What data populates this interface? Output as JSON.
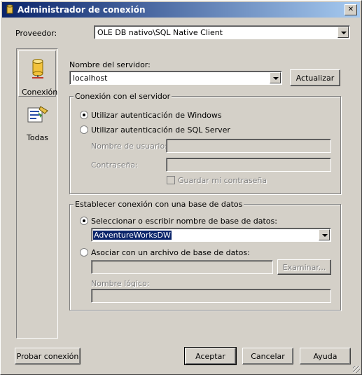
{
  "window": {
    "title": "Administrador de conexión"
  },
  "provider": {
    "label": "Proveedor:",
    "value": "OLE DB nativo\\SQL Native Client"
  },
  "sidebar": {
    "items": [
      {
        "label": "Conexión",
        "icon": "database-cylinder-icon",
        "selected": true
      },
      {
        "label": "Todas",
        "icon": "properties-icon",
        "selected": false
      }
    ]
  },
  "server": {
    "label": "Nombre del servidor:",
    "value": "localhost",
    "refresh_label": "Actualizar"
  },
  "logon": {
    "group_title": "Conexión con el servidor",
    "windows_auth_label": "Utilizar autenticación de Windows",
    "sql_auth_label": "Utilizar autenticación de SQL Server",
    "windows_auth_selected": true,
    "username_label": "Nombre de usuario:",
    "username_value": "",
    "password_label": "Contraseña:",
    "password_value": "",
    "save_password_label": "Guardar mi contraseña",
    "save_password_checked": false
  },
  "database": {
    "group_title": "Establecer conexión con una base de datos",
    "select_label": "Seleccionar o escribir nombre de base de datos:",
    "select_value": "AdventureWorksDW",
    "attach_label": "Asociar con un archivo de base de datos:",
    "attach_value": "",
    "browse_label": "Examinar...",
    "logical_name_label": "Nombre lógico:",
    "logical_name_value": "",
    "select_mode_selected": true
  },
  "footer": {
    "test_label": "Probar conexión",
    "ok_label": "Aceptar",
    "cancel_label": "Cancelar",
    "help_label": "Ayuda"
  },
  "colors": {
    "titlebar_start": "#0a246a",
    "titlebar_end": "#a6caf0",
    "face": "#d4d0c8",
    "selection": "#0a246a"
  }
}
